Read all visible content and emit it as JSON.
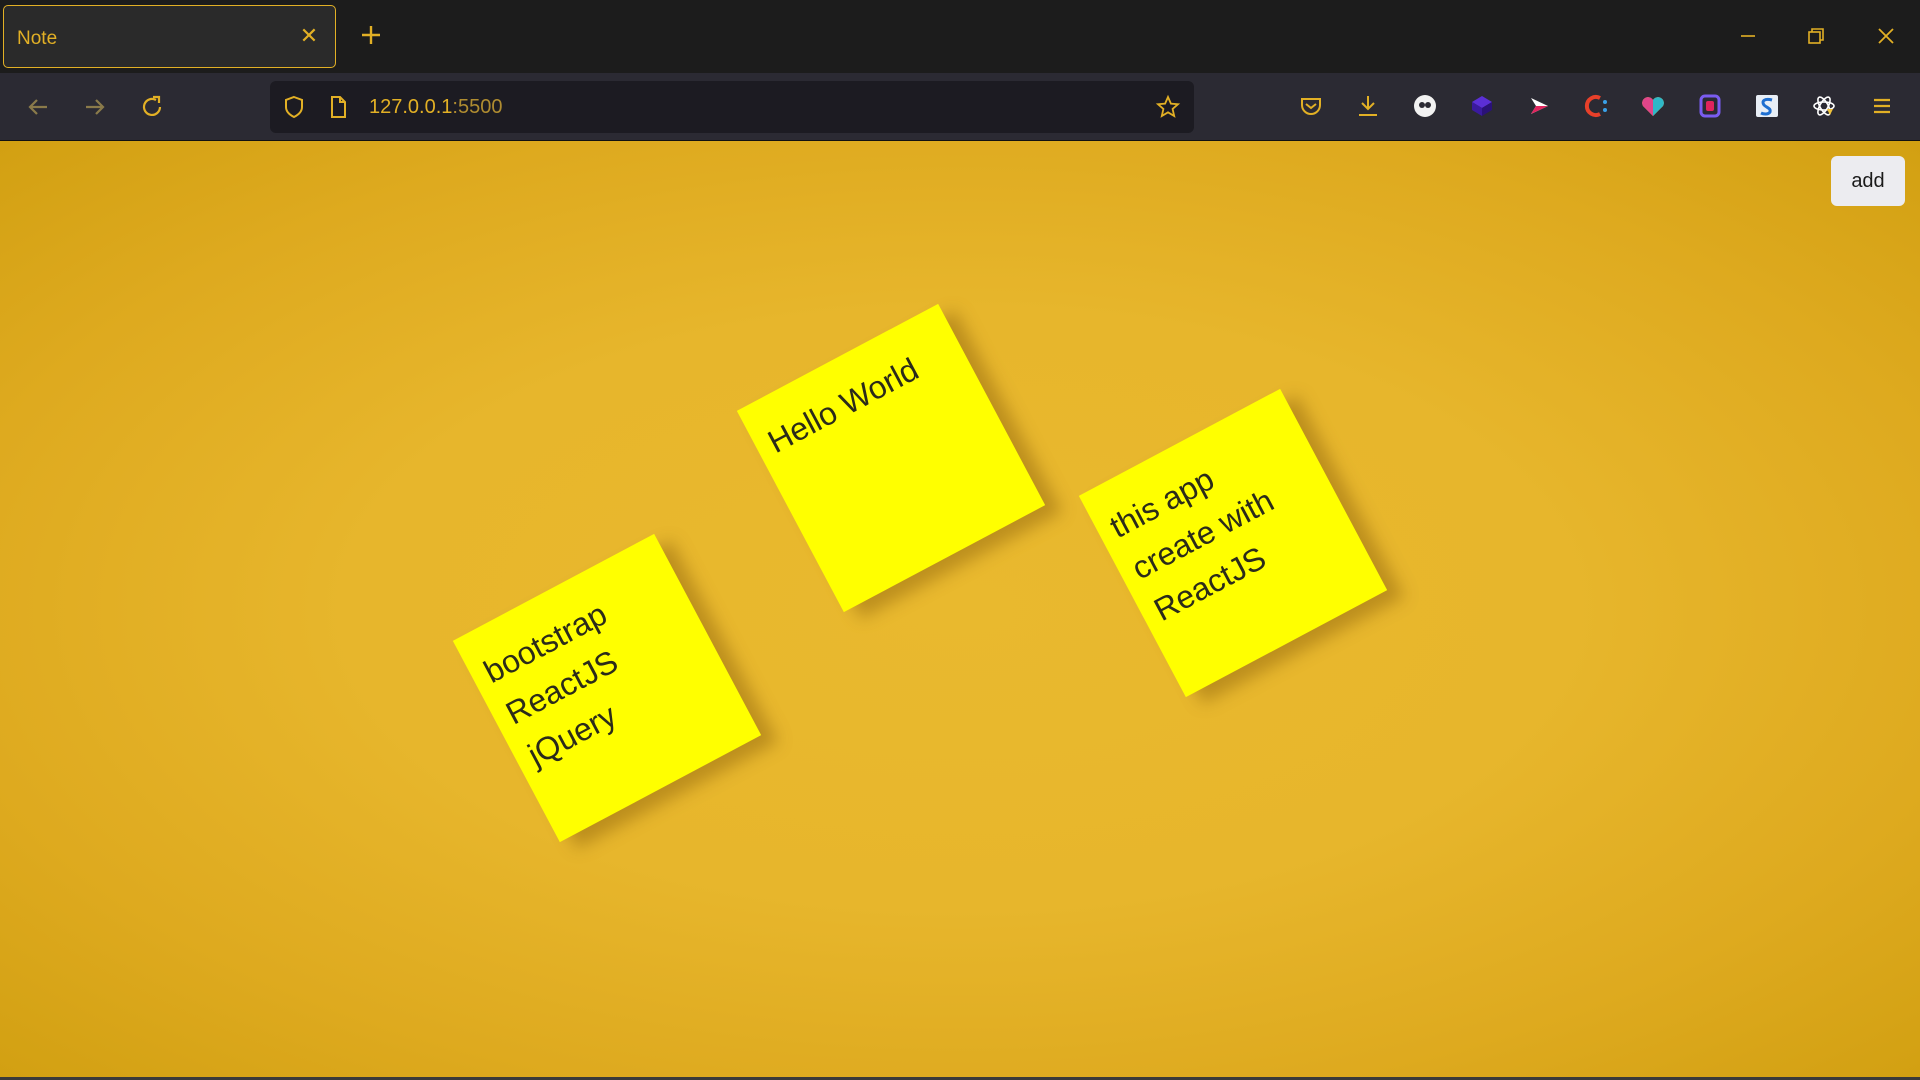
{
  "browser": {
    "tab": {
      "title": "Note"
    },
    "url": {
      "host": "127.0.0.1",
      "port": ":5500"
    }
  },
  "page": {
    "add_label": "add",
    "notes": [
      {
        "text": "bootstrap\nReactJS\njQuery"
      },
      {
        "text": "Hello World"
      },
      {
        "text": "this app\ncreate with\nReactJS"
      }
    ]
  },
  "icons": {
    "back": "arrow-left-icon",
    "forward": "arrow-right-icon",
    "reload": "reload-icon",
    "shield": "shield-icon",
    "page": "page-icon",
    "bookmark": "star-icon",
    "pocket": "pocket-icon",
    "downloads": "download-icon",
    "menu": "hamburger-menu-icon"
  },
  "colors": {
    "accent": "#e2b025",
    "note": "#ffff00",
    "page_bg": "#e7b62c"
  }
}
